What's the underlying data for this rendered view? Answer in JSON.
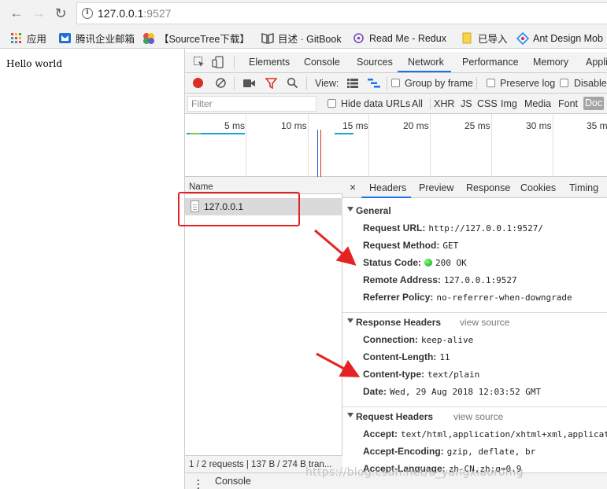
{
  "browser": {
    "url_host": "127.0.0.1",
    "url_port": ":9527",
    "bookmarks": [
      {
        "label": "应用",
        "icon": "apps-grid-icon"
      },
      {
        "label": "腾讯企业邮箱",
        "icon": "tencent-mail-icon"
      },
      {
        "label": "【SourceTree下载】",
        "icon": "sourcetree-icon"
      },
      {
        "label": "目述 · GitBook",
        "icon": "gitbook-icon"
      },
      {
        "label": "Read Me - Redux",
        "icon": "redux-icon"
      },
      {
        "label": "已导入",
        "icon": "folder-icon"
      },
      {
        "label": "Ant Design Mob",
        "icon": "antdesign-icon"
      }
    ]
  },
  "page": {
    "text": "Hello world"
  },
  "devtools": {
    "tabs": [
      "Elements",
      "Console",
      "Sources",
      "Network",
      "Performance",
      "Memory",
      "Appli"
    ],
    "active_tab": "Network",
    "network_toolbar": {
      "view_label": "View:",
      "group_by_frame": "Group by frame",
      "preserve_log": "Preserve log",
      "disable_cache": "Disable"
    },
    "filter": {
      "placeholder": "Filter",
      "hide_data_urls": "Hide data URLs",
      "types": [
        "All",
        "XHR",
        "JS",
        "CSS",
        "Img",
        "Media",
        "Font",
        "Doc"
      ],
      "active_type": "Doc"
    },
    "timeline_ticks": [
      "5 ms",
      "10 ms",
      "15 ms",
      "20 ms",
      "25 ms",
      "30 ms",
      "35 m"
    ],
    "name_column_header": "Name",
    "requests": [
      {
        "name": "127.0.0.1"
      }
    ],
    "status_bar": "1 / 2 requests  |  137 B / 274 B tran...",
    "console_drawer": "Console",
    "detail_tabs": [
      "Headers",
      "Preview",
      "Response",
      "Cookies",
      "Timing"
    ],
    "active_detail_tab": "Headers",
    "general": {
      "title": "General",
      "rows": [
        {
          "key": "Request URL:",
          "value": "http://127.0.0.1:9527/"
        },
        {
          "key": "Request Method:",
          "value": "GET"
        },
        {
          "key": "Status Code:",
          "value": "200 OK"
        },
        {
          "key": "Remote Address:",
          "value": "127.0.0.1:9527"
        },
        {
          "key": "Referrer Policy:",
          "value": "no-referrer-when-downgrade"
        }
      ]
    },
    "response_headers": {
      "title": "Response Headers",
      "view_source": "view source",
      "rows": [
        {
          "key": "Connection:",
          "value": "keep-alive"
        },
        {
          "key": "Content-Length:",
          "value": "11"
        },
        {
          "key": "Content-type:",
          "value": "text/plain"
        },
        {
          "key": "Date:",
          "value": "Wed, 29 Aug 2018 12:03:52 GMT"
        }
      ]
    },
    "request_headers": {
      "title": "Request Headers",
      "view_source": "view source",
      "rows": [
        {
          "key": "Accept:",
          "value": "text/html,application/xhtml+xml,applicat"
        },
        {
          "key": "Accept-Encoding:",
          "value": "gzip, deflate, br"
        },
        {
          "key": "Accept-Language:",
          "value": "zh-CN,zh;q=0.9"
        }
      ]
    }
  },
  "watermark": "https://blog.csdn.net/u_yangxiaoromg",
  "colors": {
    "accent": "#1a73e8",
    "record_red": "#d93025",
    "annotation_red": "#e52222",
    "status_green": "#0c9a0c"
  }
}
